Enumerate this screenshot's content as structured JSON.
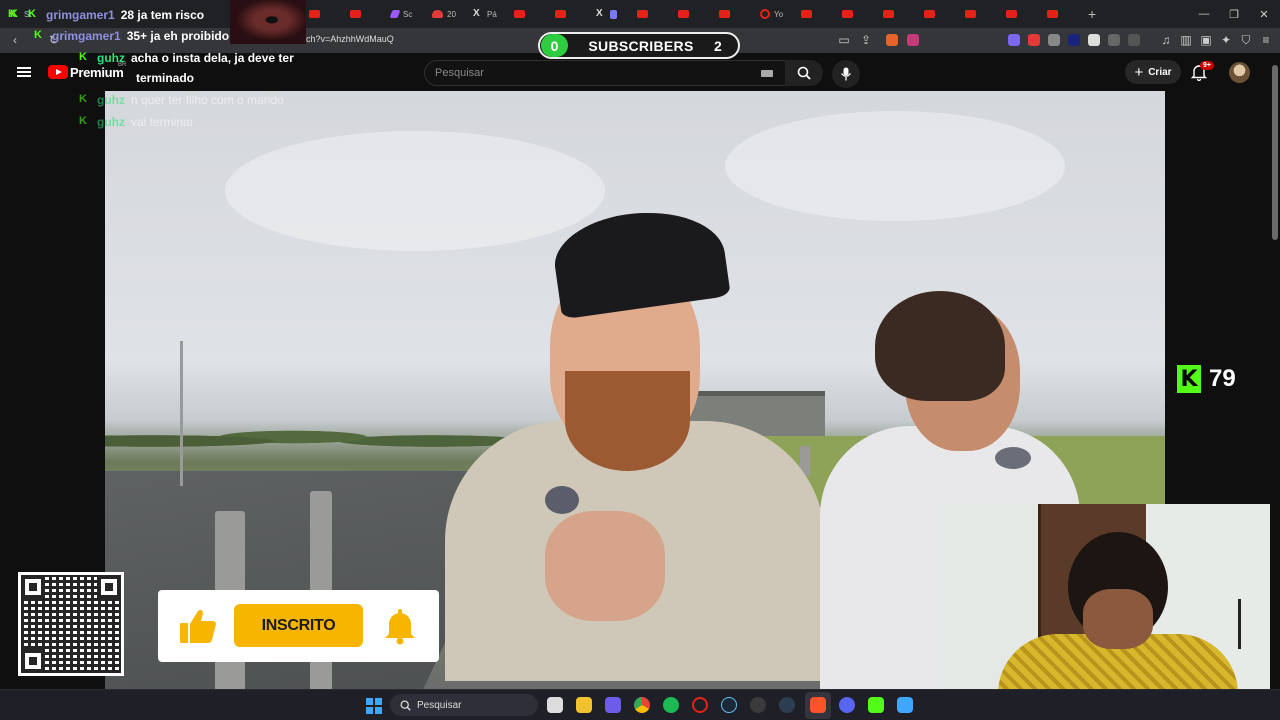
{
  "browser": {
    "tab_labels": [
      "Sc",
      "20",
      "Pá",
      "Yo"
    ],
    "address_url_fragment": "ch?v=AhzhhWdMauQ",
    "new_tab_icon": "plus-icon"
  },
  "youtube": {
    "brand": "Premium",
    "country_code": "BR",
    "search_placeholder": "Pesquisar",
    "create_label": "Criar",
    "notification_badge": "9+"
  },
  "chat": [
    {
      "user": "grimgamer1",
      "message": "28 ja tem risco"
    },
    {
      "user": "grimgamer1",
      "message": "35+ ja eh proibido"
    },
    {
      "user": "guhz",
      "message": "acha o insta dela, ja deve ter"
    },
    {
      "user": "",
      "message": "terminado"
    },
    {
      "user": "guhz",
      "message": "n quer ter filho com o marido"
    },
    {
      "user": "guhz",
      "message": "vai terminar"
    }
  ],
  "subscriber_counter": {
    "left": "0",
    "label": "SUBSCRIBERS",
    "right": "2"
  },
  "viewers": {
    "count": "79"
  },
  "subscribe_overlay": {
    "button_label": "INSCRITO"
  },
  "taskbar": {
    "search_label": "Pesquisar"
  },
  "colors": {
    "kick_green": "#53fc18",
    "inscrito_yellow": "#f7b500",
    "youtube_red": "#ff0000",
    "subs_green": "#2ecc40"
  }
}
